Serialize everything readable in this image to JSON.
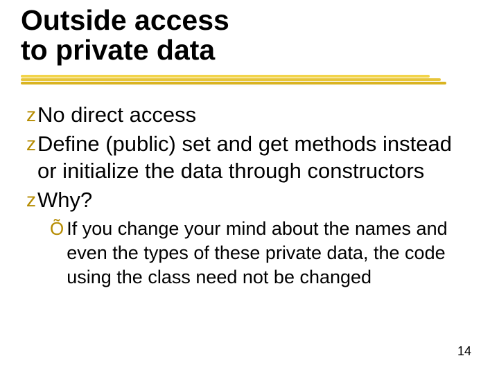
{
  "title_line1": "Outside access",
  "title_line2": "to private data",
  "bullets": [
    {
      "text": "No direct access"
    },
    {
      "text": "Define (public) set and get methods instead or initialize the data through constructors"
    },
    {
      "text": "Why?"
    }
  ],
  "sub_bullets": [
    {
      "text": "If you change your mind about the names and even the types of these private data, the code using the class need not be changed"
    }
  ],
  "glyphs": {
    "level1": "z",
    "level2": "Õ"
  },
  "page_number": "14"
}
